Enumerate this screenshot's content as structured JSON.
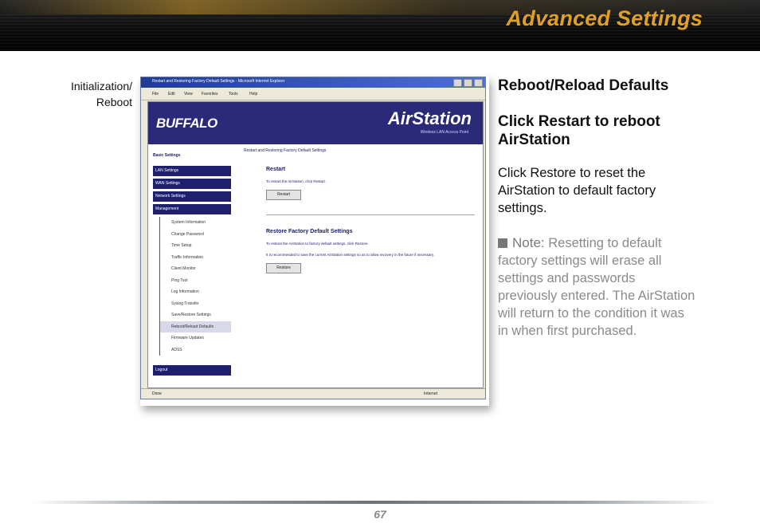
{
  "header": {
    "title": "Advanced Settings"
  },
  "caption": {
    "line1": "Initialization/",
    "line2": "Reboot"
  },
  "screenshot": {
    "window_title": "Restart and Restoring Factory Default Settings - Microsoft Internet Explorer",
    "menu": [
      "File",
      "Edit",
      "View",
      "Favorites",
      "Tools",
      "Help"
    ],
    "brand_left": "BUFFALO",
    "brand_right": "AirStation",
    "brand_sub": "Wireless LAN Access Point",
    "sidebar": {
      "basic": "Basic Settings",
      "nav": [
        "LAN Settings",
        "WAN Settings",
        "Network Settings",
        "Management"
      ],
      "sub": [
        "System Information",
        "Change Password",
        "Time Setup",
        "Traffic Information",
        "Client Monitor",
        "Ping Tool",
        "Log Information",
        "Syslog Transfer",
        "Save/Restore Settings",
        "Reboot/Reload Defaults",
        "Firmware Updates",
        "ADSS"
      ],
      "logout": "Logout"
    },
    "content": {
      "crumb": "Restart and Restoring Factory Default Settings",
      "restart_title": "Restart",
      "restart_text": "To restart the AirStation, click Restart.",
      "restart_btn": "Restart",
      "restore_title": "Restore Factory Default Settings",
      "restore_text1": "To restore the AirStation to factory default settings, click Restore.",
      "restore_text2": "It is recommended to save the current AirStation settings so as to allow recovery in the future if necessary.",
      "restore_btn": "Restore"
    },
    "status_left": "Done",
    "status_right": "Internet"
  },
  "right": {
    "heading": "Reboot/Reload Defaults",
    "subheading": "Click Restart to reboot AirStation",
    "paragraph": "Click Restore to reset the AirStation to default factory settings.",
    "note_label": "Note:",
    "note_text": "Resetting to default factory settings will erase all settings and passwords previously entered.  The AirStation will return to the condition it was in when first purchased."
  },
  "footer": {
    "page_number": "67"
  }
}
